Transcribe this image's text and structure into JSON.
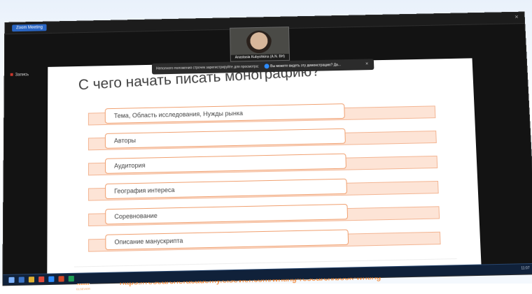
{
  "meeting": {
    "tab_label": "Zoom Meeting",
    "side_label": "Запись",
    "participant_name": "Anastasia Kubyshkina (A.N. BH)",
    "notification_text": "Неполного положения строчек зарегистрируйте для просмотра:",
    "notification_question": "Вы можете видеть эту демонстрацию? Да...",
    "close": "×"
  },
  "slide": {
    "title": "С чего начать писать монографию?",
    "items": [
      "Тема, Область исследования, Нужды рынка",
      "Авторы",
      "Аудитория",
      "География интереса",
      "Соревнование",
      "Описание манускрипта"
    ],
    "logo_text": "ELSEVIER",
    "url": "https://researcheracademy.elsevier.com/writing-research/book-writing"
  },
  "taskbar": {
    "clock": "11:07"
  },
  "colors": {
    "accent_orange": "#f47c20",
    "band_fill": "#fde4d6",
    "box_border": "#f0a070"
  }
}
